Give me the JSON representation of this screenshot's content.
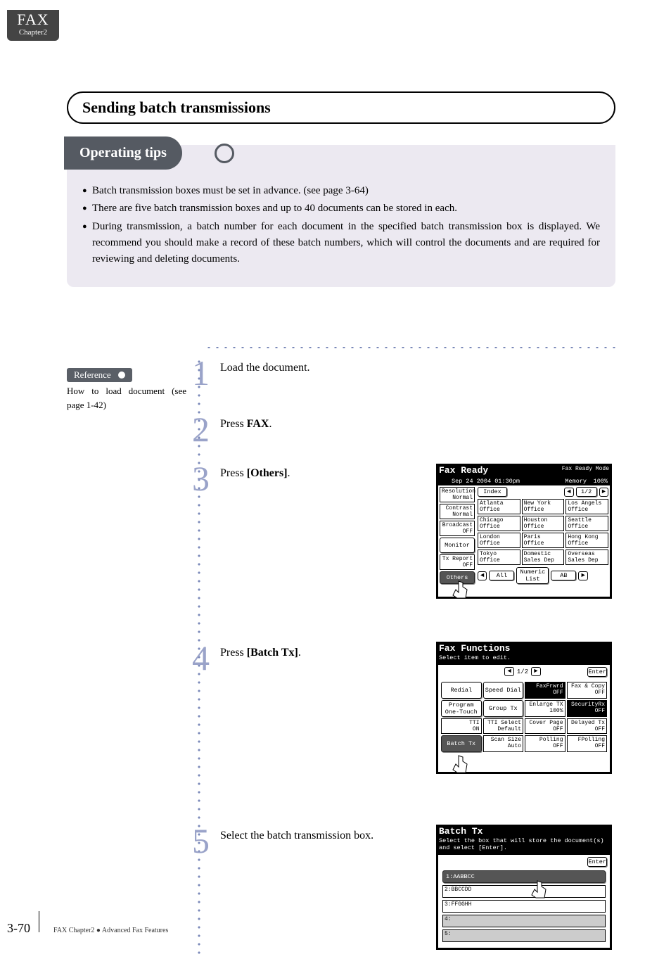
{
  "tab": {
    "title": "FAX",
    "sub": "Chapter2"
  },
  "section_title": "Sending batch transmissions",
  "tips": {
    "header": "Operating tips",
    "items": [
      "Batch transmission boxes must be set in advance. (see page 3-64)",
      "There are five batch transmission boxes and up to 40 documents can be stored in each.",
      "During transmission, a batch number for each document in the specified batch transmission box is displayed. We recommend you should make a record of these batch numbers, which will control the documents and are required for reviewing and deleting documents."
    ]
  },
  "reference": {
    "label": "Reference",
    "text": "How to load document (see page 1-42)"
  },
  "steps": {
    "1": "Load the document.",
    "2_pre": "Press ",
    "2_b": "FAX",
    "2_post": ".",
    "3_pre": "Press ",
    "3_b": "[Others]",
    "3_post": ".",
    "4_pre": "Press ",
    "4_b": "[Batch Tx]",
    "4_post": ".",
    "5": "Select the batch transmission box."
  },
  "screen1": {
    "title": "Fax Ready",
    "mode": "Fax Ready Mode",
    "date": "Sep 24 2004 01:30pm",
    "mem": "Memory",
    "mempct": "100%",
    "pages": "1/2",
    "left": [
      "Resolution\nNormal",
      "Contrast\nNormal",
      "Broadcast\nOFF",
      "Monitor",
      "Tx Report\nOFF",
      "Others"
    ],
    "index": "Index",
    "grid": [
      [
        "Atlanta\nOffice",
        "New York\nOffice",
        "Los Angels\nOffice"
      ],
      [
        "Chicago\nOffice",
        "Houston\nOffice",
        "Seattle\nOffice"
      ],
      [
        "London\nOffice",
        "Paris\nOffice",
        "Hong Kong\nOffice"
      ],
      [
        "Tokyo\nOffice",
        "Domestic\nSales Dep",
        "Overseas\nSales Dep"
      ]
    ],
    "bottom": {
      "all": "All",
      "numlist": "Numeric\nList",
      "ab": "AB"
    }
  },
  "screen2": {
    "title": "Fax Functions",
    "sub": "Select item to edit.",
    "pages": "1/2",
    "enter": "Enter",
    "grid": [
      [
        "Redial",
        "Speed Dial",
        "FaxFrwrd\nOFF",
        "Fax & Copy\nOFF"
      ],
      [
        "Program\nOne-Touch",
        "Group Tx",
        "Enlarge TX\n100%",
        "SecurityRx\nOFF"
      ],
      [
        "TTI\nON",
        "TTI Select\nDefault",
        "Cover Page\nOFF",
        "Delayed Tx\nOFF"
      ],
      [
        "Batch Tx",
        "Scan Size\nAuto",
        "Polling\nOFF",
        "FPolling\nOFF"
      ]
    ]
  },
  "screen3": {
    "title": "Batch Tx",
    "sub": "Select the box that will store the document(s) and select [Enter].",
    "enter": "Enter",
    "items": [
      "1:AABBCC",
      "2:BBCCDD",
      "3:FFGGHH",
      "4:",
      "5:"
    ]
  },
  "footer": {
    "page": "3-70",
    "text": "FAX Chapter2 ● Advanced Fax Features"
  }
}
